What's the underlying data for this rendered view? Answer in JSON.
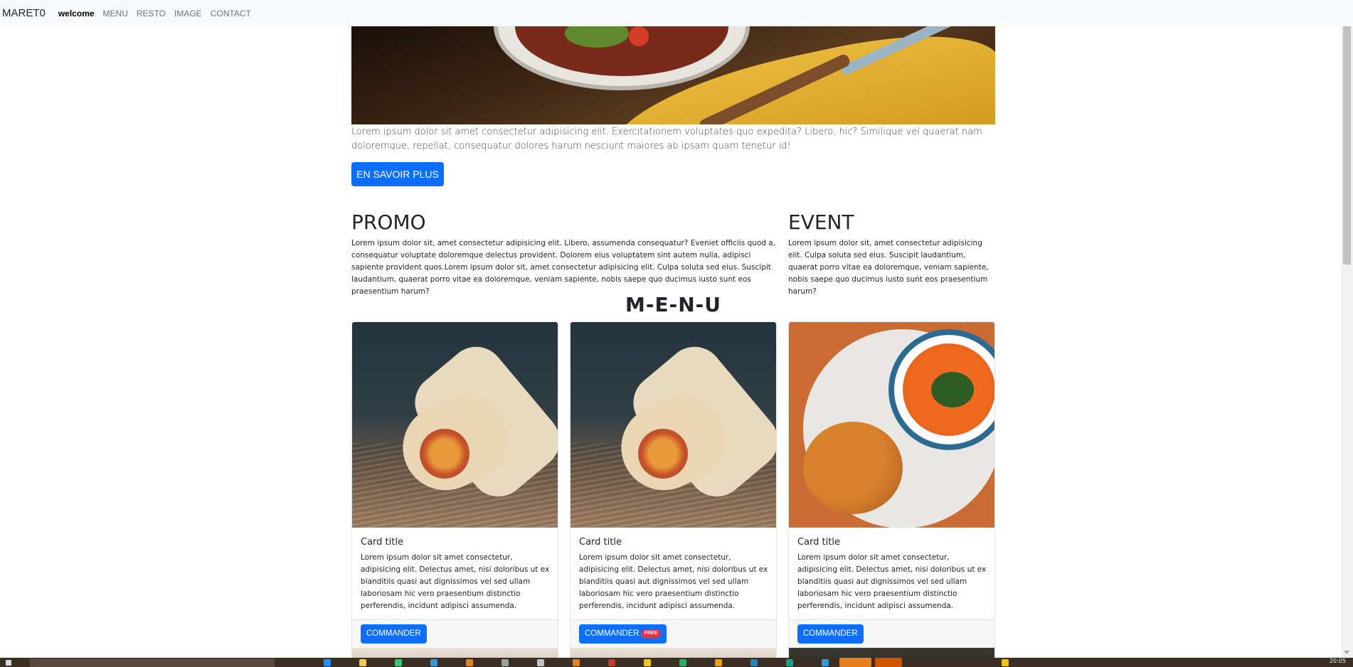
{
  "navbar": {
    "brand": "MARET0",
    "links": [
      "welcome",
      "MENU",
      "RESTO",
      "IMAGE",
      "CONTACT"
    ],
    "active_index": 0
  },
  "hero": {
    "text": "Lorem ipsum dolor sit amet consectetur adipisicing elit. Exercitationem voluptates quo expedita? Libero, hic? Similique vel quaerat nam doloremque, repellat, consequatur dolores harum nesciunt maiores ab ipsam quam tenetur id!",
    "button_label": "EN SAVOIR PLUS"
  },
  "promo": {
    "title": "PROMO",
    "text": "Lorem ipsum dolor sit, amet consectetur adipisicing elit. Libero, assumenda consequatur? Eveniet officiis quod a, consequatur voluptate doloremque delectus provident. Dolorem eius voluptatem sint autem nulla, adipisci sapiente provident quos.Lorem ipsum dolor sit, amet consectetur adipisicing elit. Culpa soluta sed eius. Suscipit laudantium, quaerat porro vitae ea doloremque, veniam sapiente, nobis saepe quo ducimus iusto sunt eos praesentium harum?"
  },
  "event": {
    "title": "EVENT",
    "text": "Lorem ipsum dolor sit, amet consectetur adipisicing elit. Culpa soluta sed eius. Suscipit laudantium, quaerat porro vitae ea doloremque, veniam sapiente, nobis saepe quo ducimus iusto sunt eos praesentium harum?"
  },
  "menu": {
    "title": "M-E-N-U",
    "cards": [
      {
        "title": "Card title",
        "text": "Lorem ipsum dolor sit amet consectetur, adipisicing elit. Delectus amet, nisi doloribus ut ex blanditiis quasi aut dignissimos vel sed ullam laboriosam hic vero praesentium distinctio perferendis, incidunt adipisci assumenda.",
        "button_label": "COMMANDER",
        "badge": "",
        "image": "burrito-image"
      },
      {
        "title": "Card title",
        "text": "Lorem ipsum dolor sit amet consectetur, adipisicing elit. Delectus amet, nisi doloribus ut ex blanditiis quasi aut dignissimos vel sed ullam laboriosam hic vero praesentium distinctio perferendis, incidunt adipisci assumenda.",
        "button_label": "COMMANDER",
        "badge": "FREE",
        "image": "burrito-image"
      },
      {
        "title": "Card title",
        "text": "Lorem ipsum dolor sit amet consectetur, adipisicing elit. Delectus amet, nisi doloribus ut ex blanditiis quasi aut dignissimos vel sed ullam laboriosam hic vero praesentium distinctio perferendis, incidunt adipisci assumenda.",
        "button_label": "COMMANDER",
        "badge": "",
        "image": "soup-and-bun-image"
      }
    ]
  },
  "colors": {
    "primary": "#0d6efd",
    "badge": "#dc3545",
    "navbar_bg": "#f8f9fa"
  },
  "taskbar": {
    "clock": "20:05"
  }
}
